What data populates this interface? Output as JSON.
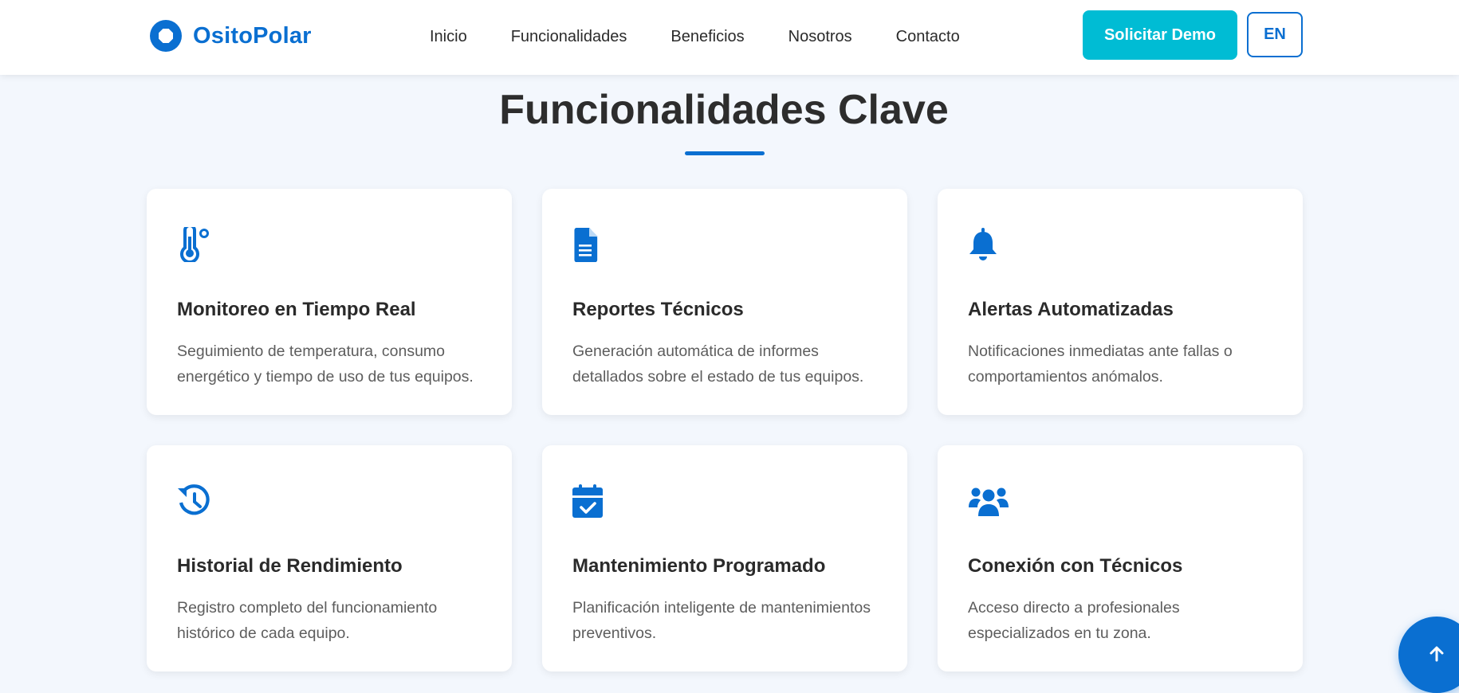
{
  "header": {
    "logo_text": "OsitoPolar",
    "nav": [
      "Inicio",
      "Funcionalidades",
      "Beneficios",
      "Nosotros",
      "Contacto"
    ],
    "demo_label": "Solicitar Demo",
    "lang_label": "EN"
  },
  "section": {
    "title": "Funcionalidades Clave"
  },
  "features": [
    {
      "icon": "thermometer-icon",
      "title": "Monitoreo en Tiempo Real",
      "desc": "Seguimiento de temperatura, consumo energético y tiempo de uso de tus equipos."
    },
    {
      "icon": "document-icon",
      "title": "Reportes Técnicos",
      "desc": "Generación automática de informes detallados sobre el estado de tus equipos."
    },
    {
      "icon": "bell-icon",
      "title": "Alertas Automatizadas",
      "desc": "Notificaciones inmediatas ante fallas o comportamientos anómalos."
    },
    {
      "icon": "history-icon",
      "title": "Historial de Rendimiento",
      "desc": "Registro completo del funcionamiento histórico de cada equipo."
    },
    {
      "icon": "calendar-check-icon",
      "title": "Mantenimiento Programado",
      "desc": "Planificación inteligente de mantenimientos preventivos."
    },
    {
      "icon": "users-icon",
      "title": "Conexión con Técnicos",
      "desc": "Acceso directo a profesionales especializados en tu zona."
    }
  ],
  "colors": {
    "brand": "#0a6fd1",
    "accent": "#00bcd4",
    "background": "#f3f7fd"
  }
}
